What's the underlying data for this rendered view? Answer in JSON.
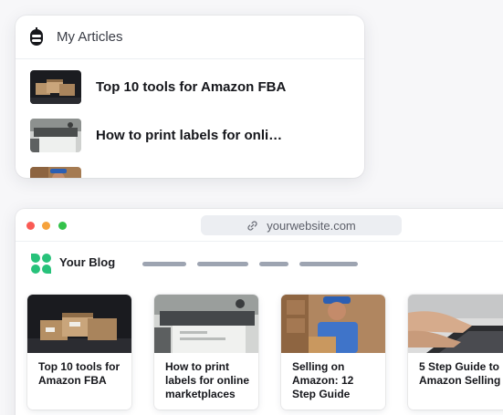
{
  "articles_panel": {
    "title": "My Articles",
    "items": [
      {
        "title": "Top 10 tools for Amazon FBA",
        "thumb": "boxes-image"
      },
      {
        "title": "How to print labels for online…",
        "thumb": "printer-image"
      },
      {
        "title": "",
        "thumb": "delivery-image"
      }
    ]
  },
  "browser": {
    "url": "yourwebsite.com",
    "window_controls": [
      "close",
      "minimize",
      "maximize"
    ]
  },
  "blog": {
    "name": "Your Blog",
    "cards": [
      {
        "title": "Top 10 tools for Amazon FBA",
        "image": "boxes-image"
      },
      {
        "title": "How to print labels for online marketplaces",
        "image": "printer-image"
      },
      {
        "title": "Selling on Amazon: 12 Step Guide",
        "image": "delivery-image"
      },
      {
        "title": "5 Step Guide to Amazon Selling",
        "image": "laptop-typing-image"
      }
    ]
  },
  "colors": {
    "close": "#fa5a54",
    "minimize": "#f6a23c",
    "maximize": "#33c24a",
    "brand_green": "#27c27a"
  }
}
